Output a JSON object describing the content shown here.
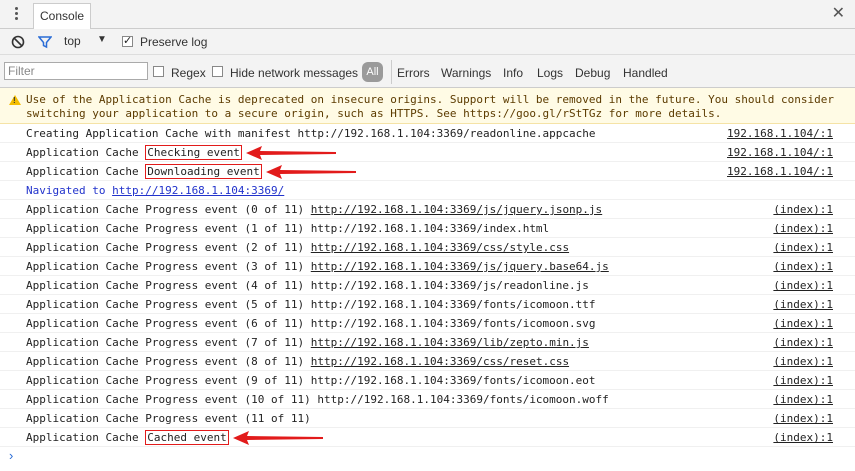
{
  "tabbar": {
    "tab_label": "Console",
    "close_glyph": "✕",
    "menu_icon": "kebab-menu-icon"
  },
  "toolbar": {
    "context": "top",
    "preserve_log_label": "Preserve log",
    "preserve_log_checked": true
  },
  "filterbar": {
    "filter_placeholder": "Filter",
    "regex_label": "Regex",
    "hide_network_label": "Hide network messages",
    "all_label": "All",
    "levels": [
      "Errors",
      "Warnings",
      "Info",
      "Logs",
      "Debug",
      "Handled"
    ]
  },
  "warning": {
    "text": "Use of the Application Cache is deprecated on insecure origins. Support will be removed in the future. You should consider\nswitching your application to a secure origin, such as HTTPS. See https://goo.gl/rStTGz for more details."
  },
  "logs": [
    {
      "pre": "Creating Application Cache with manifest http://192.168.1.104:3369/readonline.appcache",
      "boxed": "",
      "link": "",
      "src": "192.168.1.104/:1"
    },
    {
      "pre": "Application Cache ",
      "boxed": "Checking event",
      "link": "",
      "src": "192.168.1.104/:1"
    },
    {
      "pre": "Application Cache ",
      "boxed": "Downloading event",
      "link": "",
      "src": "192.168.1.104/:1"
    },
    {
      "pre": "Navigated to ",
      "boxed": "",
      "link": "http://192.168.1.104:3369/",
      "src": "",
      "blue": true
    },
    {
      "pre": "Application Cache Progress event (0 of 11) ",
      "boxed": "",
      "link": "http://192.168.1.104:3369/js/jquery.jsonp.js",
      "src": "(index):1"
    },
    {
      "pre": "Application Cache Progress event (1 of 11) http://192.168.1.104:3369/index.html",
      "boxed": "",
      "link": "",
      "src": "(index):1"
    },
    {
      "pre": "Application Cache Progress event (2 of 11) ",
      "boxed": "",
      "link": "http://192.168.1.104:3369/css/style.css",
      "src": "(index):1"
    },
    {
      "pre": "Application Cache Progress event (3 of 11) ",
      "boxed": "",
      "link": "http://192.168.1.104:3369/js/jquery.base64.js",
      "src": "(index):1"
    },
    {
      "pre": "Application Cache Progress event (4 of 11) http://192.168.1.104:3369/js/readonline.js",
      "boxed": "",
      "link": "",
      "src": "(index):1"
    },
    {
      "pre": "Application Cache Progress event (5 of 11) http://192.168.1.104:3369/fonts/icomoon.ttf",
      "boxed": "",
      "link": "",
      "src": "(index):1"
    },
    {
      "pre": "Application Cache Progress event (6 of 11) http://192.168.1.104:3369/fonts/icomoon.svg",
      "boxed": "",
      "link": "",
      "src": "(index):1"
    },
    {
      "pre": "Application Cache Progress event (7 of 11) ",
      "boxed": "",
      "link": "http://192.168.1.104:3369/lib/zepto.min.js",
      "src": "(index):1"
    },
    {
      "pre": "Application Cache Progress event (8 of 11) ",
      "boxed": "",
      "link": "http://192.168.1.104:3369/css/reset.css",
      "src": "(index):1"
    },
    {
      "pre": "Application Cache Progress event (9 of 11) http://192.168.1.104:3369/fonts/icomoon.eot",
      "boxed": "",
      "link": "",
      "src": "(index):1"
    },
    {
      "pre": "Application Cache Progress event (10 of 11) http://192.168.1.104:3369/fonts/icomoon.woff",
      "boxed": "",
      "link": "",
      "src": "(index):1"
    },
    {
      "pre": "Application Cache Progress event (11 of 11)",
      "boxed": "",
      "link": "",
      "src": "(index):1"
    },
    {
      "pre": "Application Cache ",
      "boxed": "Cached event",
      "link": "",
      "src": "(index):1"
    }
  ],
  "prompt_glyph": "›",
  "colors": {
    "annotation_red": "#e21b1b",
    "warning_bg": "#fffbe5",
    "link_blue": "#2233cc"
  }
}
